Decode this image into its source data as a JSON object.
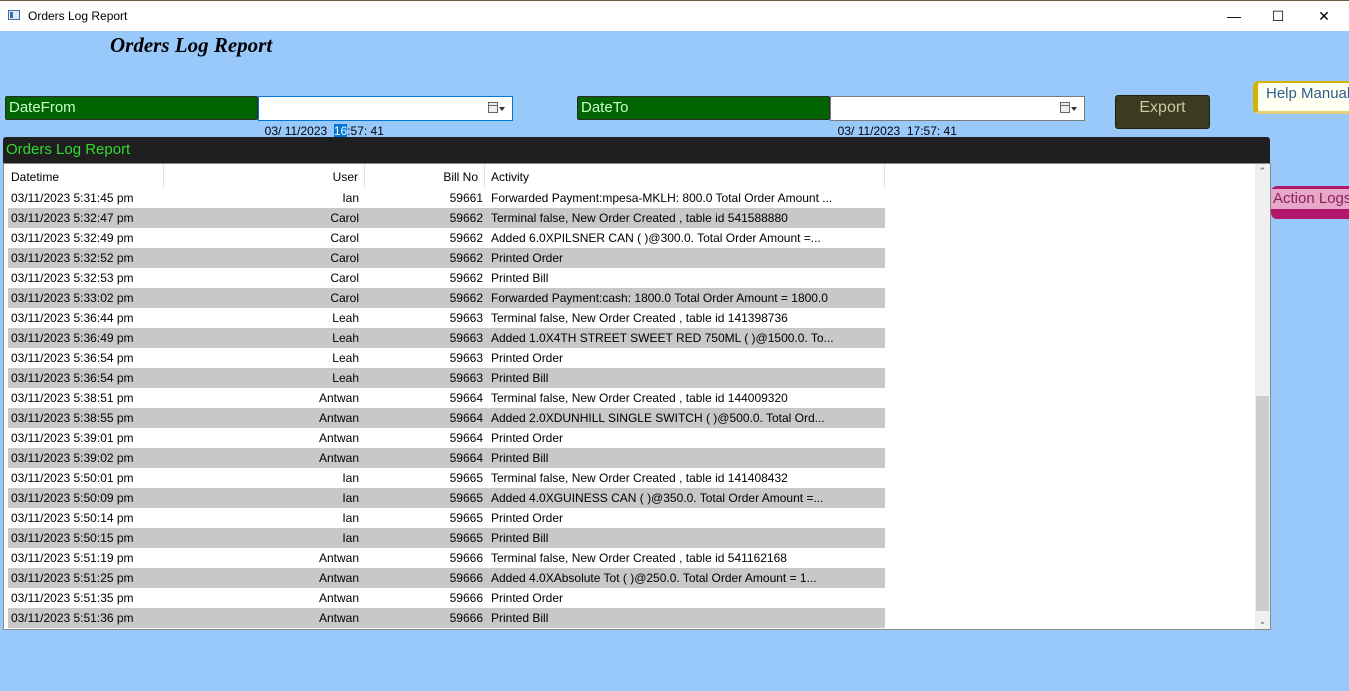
{
  "window": {
    "title": "Orders Log Report",
    "minimize": "—",
    "maximize": "☐",
    "close": "✕"
  },
  "page": {
    "heading": "Orders Log Report"
  },
  "filters": {
    "date_from_label": "DateFrom",
    "date_from_prefix": "03/ 11/2023  ",
    "date_from_selected": "16",
    "date_from_suffix": ":57: 41",
    "date_to_label": "DateTo",
    "date_to_value": "03/ 11/2023  17:57: 41"
  },
  "buttons": {
    "export": "Export",
    "help_manual": "Help Manual",
    "action_logs": "Action Logs"
  },
  "panel": {
    "title": "Orders Log Report"
  },
  "table": {
    "columns": [
      "Datetime",
      "User",
      "Bill No",
      "Activity"
    ],
    "rows": [
      {
        "datetime": "03/11/2023 5:31:45 pm",
        "user": "Ian",
        "bill": "59661",
        "activity": " Forwarded Payment:mpesa-MKLH: 800.0 Total Order Amount ..."
      },
      {
        "datetime": "03/11/2023 5:32:47 pm",
        "user": "Carol",
        "bill": "59662",
        "activity": "Terminal false, New Order Created , table id 541588880"
      },
      {
        "datetime": "03/11/2023 5:32:49 pm",
        "user": "Carol",
        "bill": "59662",
        "activity": " Added 6.0XPILSNER CAN (    )@300.0.  Total Order Amount =..."
      },
      {
        "datetime": "03/11/2023 5:32:52 pm",
        "user": "Carol",
        "bill": "59662",
        "activity": "Printed Order"
      },
      {
        "datetime": "03/11/2023 5:32:53 pm",
        "user": "Carol",
        "bill": "59662",
        "activity": "Printed Bill"
      },
      {
        "datetime": "03/11/2023 5:33:02 pm",
        "user": "Carol",
        "bill": "59662",
        "activity": " Forwarded Payment:cash: 1800.0 Total Order Amount = 1800.0"
      },
      {
        "datetime": "03/11/2023 5:36:44 pm",
        "user": "Leah",
        "bill": "59663",
        "activity": "Terminal false, New Order Created , table id 141398736"
      },
      {
        "datetime": "03/11/2023 5:36:49 pm",
        "user": "Leah",
        "bill": "59663",
        "activity": " Added 1.0X4TH STREET SWEET RED 750ML  (    )@1500.0.  To..."
      },
      {
        "datetime": "03/11/2023 5:36:54 pm",
        "user": "Leah",
        "bill": "59663",
        "activity": "Printed Order"
      },
      {
        "datetime": "03/11/2023 5:36:54 pm",
        "user": "Leah",
        "bill": "59663",
        "activity": "Printed Bill"
      },
      {
        "datetime": "03/11/2023 5:38:51 pm",
        "user": "Antwan",
        "bill": "59664",
        "activity": "Terminal false, New Order Created , table id 144009320"
      },
      {
        "datetime": "03/11/2023 5:38:55 pm",
        "user": "Antwan",
        "bill": "59664",
        "activity": " Added 2.0XDUNHILL SINGLE SWITCH (    )@500.0.  Total Ord..."
      },
      {
        "datetime": "03/11/2023 5:39:01 pm",
        "user": "Antwan",
        "bill": "59664",
        "activity": "Printed Order"
      },
      {
        "datetime": "03/11/2023 5:39:02 pm",
        "user": "Antwan",
        "bill": "59664",
        "activity": "Printed Bill"
      },
      {
        "datetime": "03/11/2023 5:50:01 pm",
        "user": "Ian",
        "bill": "59665",
        "activity": "Terminal false, New Order Created , table id 141408432"
      },
      {
        "datetime": "03/11/2023 5:50:09 pm",
        "user": "Ian",
        "bill": "59665",
        "activity": " Added 4.0XGUINESS CAN (    )@350.0.  Total Order Amount =..."
      },
      {
        "datetime": "03/11/2023 5:50:14 pm",
        "user": "Ian",
        "bill": "59665",
        "activity": "Printed Order"
      },
      {
        "datetime": "03/11/2023 5:50:15 pm",
        "user": "Ian",
        "bill": "59665",
        "activity": "Printed Bill"
      },
      {
        "datetime": "03/11/2023 5:51:19 pm",
        "user": "Antwan",
        "bill": "59666",
        "activity": "Terminal false, New Order Created , table id 541162168"
      },
      {
        "datetime": "03/11/2023 5:51:25 pm",
        "user": "Antwan",
        "bill": "59666",
        "activity": " Added 4.0XAbsolute Tot (    )@250.0.  Total Order Amount = 1..."
      },
      {
        "datetime": "03/11/2023 5:51:35 pm",
        "user": "Antwan",
        "bill": "59666",
        "activity": "Printed Order"
      },
      {
        "datetime": "03/11/2023 5:51:36 pm",
        "user": "Antwan",
        "bill": "59666",
        "activity": "Printed Bill"
      }
    ]
  },
  "scrollbar": {
    "up_glyph": "⌃",
    "down_glyph": "⌄"
  }
}
